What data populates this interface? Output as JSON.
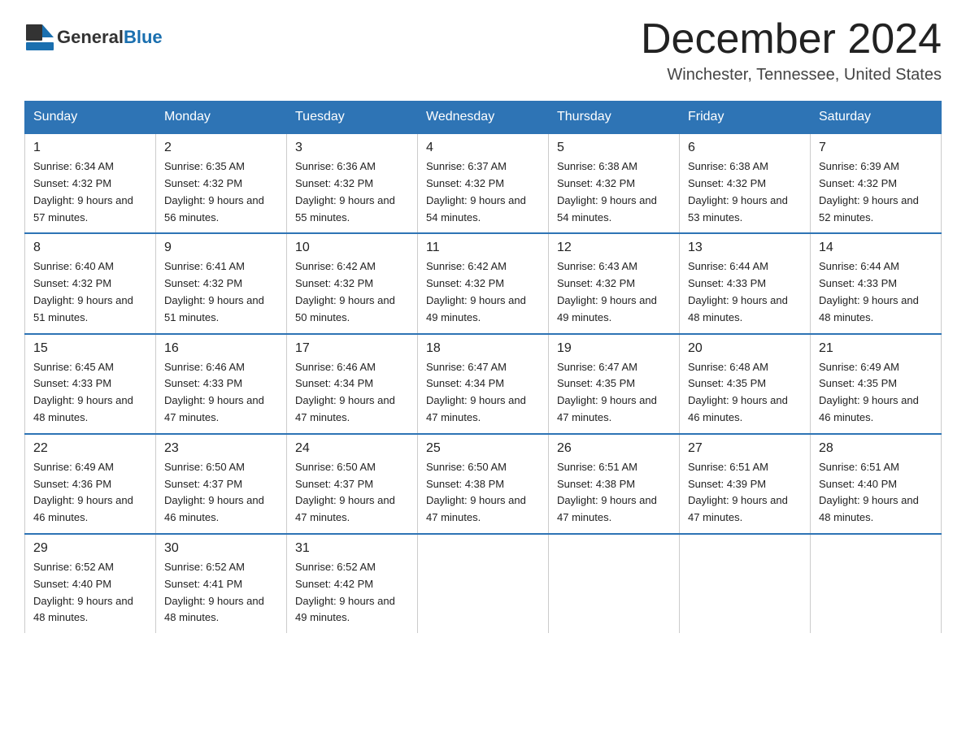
{
  "header": {
    "logo_general": "General",
    "logo_blue": "Blue",
    "month_title": "December 2024",
    "location": "Winchester, Tennessee, United States"
  },
  "calendar": {
    "weekdays": [
      "Sunday",
      "Monday",
      "Tuesday",
      "Wednesday",
      "Thursday",
      "Friday",
      "Saturday"
    ],
    "weeks": [
      [
        {
          "day": "1",
          "sunrise": "6:34 AM",
          "sunset": "4:32 PM",
          "daylight": "9 hours and 57 minutes."
        },
        {
          "day": "2",
          "sunrise": "6:35 AM",
          "sunset": "4:32 PM",
          "daylight": "9 hours and 56 minutes."
        },
        {
          "day": "3",
          "sunrise": "6:36 AM",
          "sunset": "4:32 PM",
          "daylight": "9 hours and 55 minutes."
        },
        {
          "day": "4",
          "sunrise": "6:37 AM",
          "sunset": "4:32 PM",
          "daylight": "9 hours and 54 minutes."
        },
        {
          "day": "5",
          "sunrise": "6:38 AM",
          "sunset": "4:32 PM",
          "daylight": "9 hours and 54 minutes."
        },
        {
          "day": "6",
          "sunrise": "6:38 AM",
          "sunset": "4:32 PM",
          "daylight": "9 hours and 53 minutes."
        },
        {
          "day": "7",
          "sunrise": "6:39 AM",
          "sunset": "4:32 PM",
          "daylight": "9 hours and 52 minutes."
        }
      ],
      [
        {
          "day": "8",
          "sunrise": "6:40 AM",
          "sunset": "4:32 PM",
          "daylight": "9 hours and 51 minutes."
        },
        {
          "day": "9",
          "sunrise": "6:41 AM",
          "sunset": "4:32 PM",
          "daylight": "9 hours and 51 minutes."
        },
        {
          "day": "10",
          "sunrise": "6:42 AM",
          "sunset": "4:32 PM",
          "daylight": "9 hours and 50 minutes."
        },
        {
          "day": "11",
          "sunrise": "6:42 AM",
          "sunset": "4:32 PM",
          "daylight": "9 hours and 49 minutes."
        },
        {
          "day": "12",
          "sunrise": "6:43 AM",
          "sunset": "4:32 PM",
          "daylight": "9 hours and 49 minutes."
        },
        {
          "day": "13",
          "sunrise": "6:44 AM",
          "sunset": "4:33 PM",
          "daylight": "9 hours and 48 minutes."
        },
        {
          "day": "14",
          "sunrise": "6:44 AM",
          "sunset": "4:33 PM",
          "daylight": "9 hours and 48 minutes."
        }
      ],
      [
        {
          "day": "15",
          "sunrise": "6:45 AM",
          "sunset": "4:33 PM",
          "daylight": "9 hours and 48 minutes."
        },
        {
          "day": "16",
          "sunrise": "6:46 AM",
          "sunset": "4:33 PM",
          "daylight": "9 hours and 47 minutes."
        },
        {
          "day": "17",
          "sunrise": "6:46 AM",
          "sunset": "4:34 PM",
          "daylight": "9 hours and 47 minutes."
        },
        {
          "day": "18",
          "sunrise": "6:47 AM",
          "sunset": "4:34 PM",
          "daylight": "9 hours and 47 minutes."
        },
        {
          "day": "19",
          "sunrise": "6:47 AM",
          "sunset": "4:35 PM",
          "daylight": "9 hours and 47 minutes."
        },
        {
          "day": "20",
          "sunrise": "6:48 AM",
          "sunset": "4:35 PM",
          "daylight": "9 hours and 46 minutes."
        },
        {
          "day": "21",
          "sunrise": "6:49 AM",
          "sunset": "4:35 PM",
          "daylight": "9 hours and 46 minutes."
        }
      ],
      [
        {
          "day": "22",
          "sunrise": "6:49 AM",
          "sunset": "4:36 PM",
          "daylight": "9 hours and 46 minutes."
        },
        {
          "day": "23",
          "sunrise": "6:50 AM",
          "sunset": "4:37 PM",
          "daylight": "9 hours and 46 minutes."
        },
        {
          "day": "24",
          "sunrise": "6:50 AM",
          "sunset": "4:37 PM",
          "daylight": "9 hours and 47 minutes."
        },
        {
          "day": "25",
          "sunrise": "6:50 AM",
          "sunset": "4:38 PM",
          "daylight": "9 hours and 47 minutes."
        },
        {
          "day": "26",
          "sunrise": "6:51 AM",
          "sunset": "4:38 PM",
          "daylight": "9 hours and 47 minutes."
        },
        {
          "day": "27",
          "sunrise": "6:51 AM",
          "sunset": "4:39 PM",
          "daylight": "9 hours and 47 minutes."
        },
        {
          "day": "28",
          "sunrise": "6:51 AM",
          "sunset": "4:40 PM",
          "daylight": "9 hours and 48 minutes."
        }
      ],
      [
        {
          "day": "29",
          "sunrise": "6:52 AM",
          "sunset": "4:40 PM",
          "daylight": "9 hours and 48 minutes."
        },
        {
          "day": "30",
          "sunrise": "6:52 AM",
          "sunset": "4:41 PM",
          "daylight": "9 hours and 48 minutes."
        },
        {
          "day": "31",
          "sunrise": "6:52 AM",
          "sunset": "4:42 PM",
          "daylight": "9 hours and 49 minutes."
        },
        null,
        null,
        null,
        null
      ]
    ]
  }
}
